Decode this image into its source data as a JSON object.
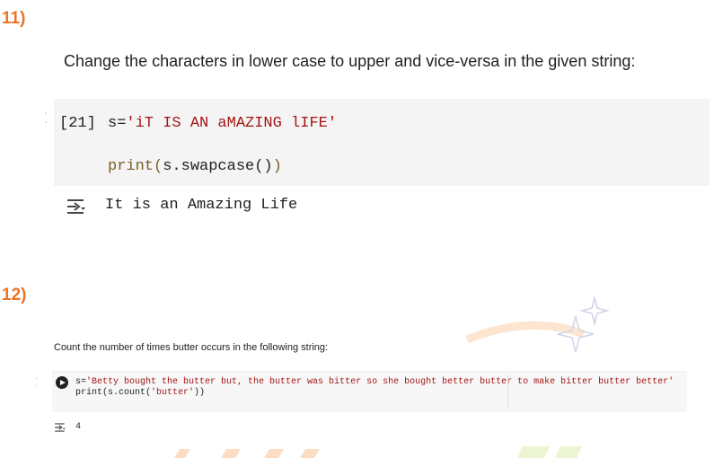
{
  "question_11": {
    "number": "11)",
    "prompt": "Change the characters in lower case to upper and vice-versa in the given string:",
    "cell": {
      "exec_count": "[21]",
      "line1_var": "s=",
      "line1_str": "'iT IS AN aMAZING lIFE'",
      "line2_prefix": "print(",
      "line2_call": "s.swapcase()",
      "line2_suffix": ")"
    },
    "output": "It is an Amazing Life"
  },
  "question_12": {
    "number": "12)",
    "prompt": "Count the number of times butter occurs in the following string:",
    "cell": {
      "line1_var": "s=",
      "line1_str": "'Betty bought the butter but, the butter was bitter so she bought better butter to make bitter butter better'",
      "line2_prefix": "print(s.count(",
      "line2_arg": "'butter'",
      "line2_suffix": "))"
    },
    "output": "4"
  },
  "icons": {
    "run": "play-circle-icon",
    "output": "output-toggle-icon",
    "watermark": "sparkle-icon"
  },
  "colors": {
    "accent": "#e8752a",
    "string": "#a31515",
    "cell_bg": "#f4f4f4"
  }
}
